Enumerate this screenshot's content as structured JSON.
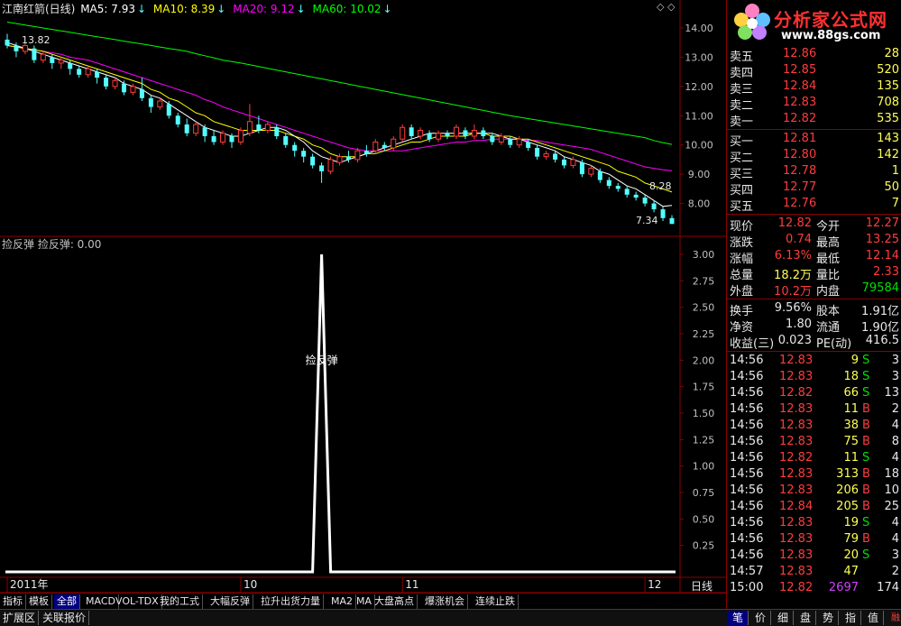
{
  "chart_header": {
    "stock": "江南红箭(日线)",
    "ma5_label": "MA5: 7.93",
    "ma10_label": "MA10: 8.39",
    "ma20_label": "MA20: 9.12",
    "ma60_label": "MA60: 10.02",
    "arrow": "↓",
    "corner_icons": "◇ ◇"
  },
  "indicator_title": "捡反弹  捡反弹: 0.00",
  "indicator_label": "捡反弹",
  "price_annotations": {
    "high": "13.82",
    "mid": "8.28",
    "low": "7.34"
  },
  "timeframe_label": "日线",
  "zoom_buttons": [
    "+",
    "-",
    "◇"
  ],
  "colors": {
    "ma5": "#ffffff",
    "ma10": "#ffff00",
    "ma20": "#ff00ff",
    "ma60": "#00ff00",
    "up": "#ff3c3c",
    "down": "#54ffff",
    "grid": "#8b0000",
    "axis_text": "#c0c0c0"
  },
  "chart_data": [
    {
      "type": "candlestick",
      "title": "江南红箭(日线)",
      "ylim": [
        7.0,
        14.4
      ],
      "yticks": [
        "14.00",
        "13.00",
        "12.00",
        "11.00",
        "10.00",
        "9.00",
        "8.00"
      ],
      "x_labels": [
        {
          "label": "2011年",
          "index": 0
        },
        {
          "label": "10",
          "index": 26
        },
        {
          "label": "11",
          "index": 44
        },
        {
          "label": "12",
          "index": 71
        }
      ],
      "candles": [
        [
          13.6,
          13.4,
          13.8,
          13.3
        ],
        [
          13.4,
          13.2,
          13.5,
          13.0
        ],
        [
          13.2,
          13.4,
          13.5,
          13.1
        ],
        [
          13.3,
          12.9,
          13.4,
          12.8
        ],
        [
          12.9,
          13.1,
          13.2,
          12.8
        ],
        [
          13.0,
          12.8,
          13.1,
          12.6
        ],
        [
          12.8,
          12.9,
          13.0,
          12.6
        ],
        [
          12.8,
          12.6,
          12.9,
          12.4
        ],
        [
          12.6,
          12.4,
          12.7,
          12.3
        ],
        [
          12.4,
          12.6,
          12.7,
          12.3
        ],
        [
          12.5,
          12.3,
          12.6,
          12.1
        ],
        [
          12.3,
          12.0,
          12.4,
          11.9
        ],
        [
          12.0,
          12.2,
          12.3,
          11.9
        ],
        [
          12.1,
          11.8,
          12.2,
          11.7
        ],
        [
          11.8,
          12.0,
          12.1,
          11.7
        ],
        [
          11.9,
          11.6,
          12.3,
          11.5
        ],
        [
          11.6,
          11.3,
          11.7,
          11.1
        ],
        [
          11.3,
          11.5,
          11.6,
          11.2
        ],
        [
          11.4,
          11.0,
          11.5,
          10.9
        ],
        [
          11.0,
          10.7,
          11.1,
          10.6
        ],
        [
          10.7,
          10.4,
          10.9,
          10.3
        ],
        [
          10.4,
          10.7,
          10.8,
          10.3
        ],
        [
          10.6,
          10.3,
          10.7,
          10.1
        ],
        [
          10.3,
          10.1,
          10.5,
          10.0
        ],
        [
          10.1,
          10.4,
          10.5,
          10.0
        ],
        [
          10.3,
          10.1,
          10.4,
          9.9
        ],
        [
          10.1,
          10.5,
          10.6,
          10.0
        ],
        [
          10.4,
          10.8,
          11.4,
          10.3
        ],
        [
          10.7,
          10.5,
          11.0,
          10.4
        ],
        [
          10.5,
          10.7,
          10.8,
          10.4
        ],
        [
          10.6,
          10.3,
          10.7,
          10.2
        ],
        [
          10.3,
          10.0,
          10.4,
          9.9
        ],
        [
          10.0,
          9.8,
          10.1,
          9.6
        ],
        [
          9.8,
          9.6,
          9.9,
          9.4
        ],
        [
          9.6,
          9.3,
          9.7,
          9.2
        ],
        [
          9.3,
          9.1,
          9.4,
          8.7
        ],
        [
          9.1,
          9.5,
          9.6,
          9.0
        ],
        [
          9.4,
          9.6,
          9.7,
          9.3
        ],
        [
          9.6,
          9.5,
          9.8,
          9.4
        ],
        [
          9.5,
          9.8,
          9.9,
          9.4
        ],
        [
          9.8,
          9.7,
          10.0,
          9.6
        ],
        [
          9.8,
          10.1,
          10.2,
          9.7
        ],
        [
          10.0,
          9.9,
          10.1,
          9.8
        ],
        [
          9.9,
          10.2,
          10.3,
          9.8
        ],
        [
          10.2,
          10.6,
          10.7,
          10.1
        ],
        [
          10.6,
          10.3,
          10.7,
          10.2
        ],
        [
          10.3,
          10.5,
          10.6,
          10.2
        ],
        [
          10.4,
          10.2,
          10.5,
          10.1
        ],
        [
          10.2,
          10.4,
          10.5,
          10.1
        ],
        [
          10.4,
          10.3,
          10.5,
          10.2
        ],
        [
          10.3,
          10.6,
          10.7,
          10.2
        ],
        [
          10.5,
          10.3,
          10.6,
          10.2
        ],
        [
          10.3,
          10.5,
          10.7,
          10.2
        ],
        [
          10.5,
          10.3,
          10.6,
          10.2
        ],
        [
          10.3,
          10.1,
          10.4,
          10.0
        ],
        [
          10.1,
          10.3,
          10.4,
          10.0
        ],
        [
          10.2,
          10.0,
          10.3,
          9.9
        ],
        [
          10.0,
          10.2,
          10.3,
          9.9
        ],
        [
          10.1,
          9.9,
          10.2,
          9.8
        ],
        [
          9.9,
          9.6,
          10.0,
          9.5
        ],
        [
          9.6,
          9.7,
          9.8,
          9.5
        ],
        [
          9.7,
          9.5,
          9.8,
          9.4
        ],
        [
          9.5,
          9.3,
          9.6,
          9.2
        ],
        [
          9.3,
          9.5,
          9.6,
          9.2
        ],
        [
          9.4,
          9.0,
          9.5,
          8.9
        ],
        [
          9.0,
          9.2,
          9.3,
          8.9
        ],
        [
          9.1,
          8.8,
          9.2,
          8.7
        ],
        [
          8.8,
          8.6,
          8.9,
          8.5
        ],
        [
          8.6,
          8.5,
          8.7,
          8.4
        ],
        [
          8.5,
          8.3,
          8.6,
          8.2
        ],
        [
          8.3,
          8.2,
          8.4,
          8.1
        ],
        [
          8.2,
          8.0,
          8.3,
          7.9
        ],
        [
          8.0,
          7.8,
          8.1,
          7.7
        ],
        [
          7.8,
          7.5,
          7.9,
          7.4
        ],
        [
          7.5,
          7.3,
          7.6,
          7.3
        ]
      ],
      "ma5": [
        13.5,
        13.4,
        13.3,
        13.2,
        13.1,
        13.0,
        12.9,
        12.8,
        12.7,
        12.6,
        12.5,
        12.4,
        12.3,
        12.1,
        12.0,
        11.9,
        11.7,
        11.6,
        11.4,
        11.2,
        11.0,
        10.8,
        10.6,
        10.5,
        10.4,
        10.3,
        10.3,
        10.4,
        10.5,
        10.6,
        10.6,
        10.5,
        10.3,
        10.1,
        9.8,
        9.6,
        9.5,
        9.4,
        9.5,
        9.6,
        9.7,
        9.8,
        9.9,
        10.0,
        10.1,
        10.2,
        10.3,
        10.4,
        10.4,
        10.4,
        10.4,
        10.4,
        10.4,
        10.4,
        10.4,
        10.3,
        10.2,
        10.2,
        10.1,
        10.0,
        9.9,
        9.8,
        9.6,
        9.5,
        9.4,
        9.3,
        9.1,
        9.0,
        8.8,
        8.6,
        8.5,
        8.3,
        8.1,
        7.9,
        7.93
      ],
      "ma10": [
        13.4,
        13.35,
        13.3,
        13.25,
        13.2,
        13.1,
        13.0,
        12.9,
        12.8,
        12.7,
        12.6,
        12.5,
        12.4,
        12.3,
        12.2,
        12.1,
        11.9,
        11.8,
        11.6,
        11.5,
        11.3,
        11.1,
        11.0,
        10.8,
        10.7,
        10.6,
        10.5,
        10.5,
        10.5,
        10.5,
        10.5,
        10.4,
        10.3,
        10.2,
        10.0,
        9.9,
        9.7,
        9.6,
        9.6,
        9.6,
        9.7,
        9.7,
        9.8,
        9.9,
        10.0,
        10.1,
        10.1,
        10.2,
        10.3,
        10.3,
        10.3,
        10.3,
        10.4,
        10.4,
        10.3,
        10.3,
        10.3,
        10.2,
        10.2,
        10.1,
        10.0,
        9.9,
        9.8,
        9.7,
        9.6,
        9.5,
        9.4,
        9.3,
        9.1,
        9.0,
        8.9,
        8.7,
        8.6,
        8.5,
        8.39
      ],
      "ma20": [
        13.4,
        13.35,
        13.3,
        13.25,
        13.2,
        13.15,
        13.1,
        13.0,
        12.95,
        12.9,
        12.8,
        12.7,
        12.6,
        12.5,
        12.4,
        12.3,
        12.2,
        12.1,
        12.0,
        11.9,
        11.8,
        11.7,
        11.55,
        11.45,
        11.3,
        11.2,
        11.1,
        11.0,
        10.9,
        10.8,
        10.7,
        10.6,
        10.5,
        10.4,
        10.3,
        10.2,
        10.1,
        10.0,
        9.9,
        9.85,
        9.8,
        9.8,
        9.8,
        9.8,
        9.8,
        9.85,
        9.9,
        9.95,
        10.0,
        10.05,
        10.1,
        10.1,
        10.15,
        10.15,
        10.2,
        10.2,
        10.2,
        10.2,
        10.15,
        10.15,
        10.1,
        10.05,
        10.0,
        9.95,
        9.9,
        9.85,
        9.75,
        9.65,
        9.55,
        9.45,
        9.35,
        9.25,
        9.2,
        9.15,
        9.12
      ],
      "ma60": [
        14.2,
        14.15,
        14.1,
        14.05,
        14.0,
        13.95,
        13.9,
        13.85,
        13.8,
        13.75,
        13.7,
        13.65,
        13.6,
        13.55,
        13.5,
        13.45,
        13.4,
        13.35,
        13.3,
        13.25,
        13.2,
        13.12,
        13.05,
        12.98,
        12.9,
        12.85,
        12.8,
        12.74,
        12.68,
        12.62,
        12.56,
        12.5,
        12.44,
        12.38,
        12.32,
        12.26,
        12.2,
        12.14,
        12.08,
        12.02,
        11.96,
        11.9,
        11.84,
        11.78,
        11.72,
        11.66,
        11.6,
        11.54,
        11.48,
        11.42,
        11.36,
        11.3,
        11.24,
        11.18,
        11.12,
        11.06,
        11.0,
        10.95,
        10.9,
        10.85,
        10.8,
        10.75,
        10.7,
        10.65,
        10.6,
        10.55,
        10.5,
        10.45,
        10.4,
        10.35,
        10.3,
        10.25,
        10.15,
        10.08,
        10.02
      ]
    },
    {
      "type": "line",
      "title": "捡反弹",
      "ylim": [
        0,
        3.0
      ],
      "yticks": [
        "3.00",
        "2.75",
        "2.50",
        "2.25",
        "2.00",
        "1.75",
        "1.50",
        "1.25",
        "1.00",
        "0.75",
        "0.50",
        "0.25"
      ],
      "spike_index": 35,
      "spike_value": 3.0
    }
  ],
  "logo": {
    "text": "分析家公式网",
    "url_text": "www.88gs.com"
  },
  "order_book": {
    "sell": [
      {
        "label": "卖五",
        "price": "12.86",
        "vol": "28"
      },
      {
        "label": "卖四",
        "price": "12.85",
        "vol": "520"
      },
      {
        "label": "卖三",
        "price": "12.84",
        "vol": "135"
      },
      {
        "label": "卖二",
        "price": "12.83",
        "vol": "708"
      },
      {
        "label": "卖一",
        "price": "12.82",
        "vol": "535"
      }
    ],
    "buy": [
      {
        "label": "买一",
        "price": "12.81",
        "vol": "143"
      },
      {
        "label": "买二",
        "price": "12.80",
        "vol": "142"
      },
      {
        "label": "买三",
        "price": "12.78",
        "vol": "1"
      },
      {
        "label": "买四",
        "price": "12.77",
        "vol": "50"
      },
      {
        "label": "买五",
        "price": "12.76",
        "vol": "7"
      }
    ]
  },
  "quote": [
    {
      "l1": "现价",
      "v1": "12.82",
      "c1": "red",
      "l2": "今开",
      "v2": "12.27",
      "c2": "red"
    },
    {
      "l1": "涨跌",
      "v1": "0.74",
      "c1": "red",
      "l2": "最高",
      "v2": "13.25",
      "c2": "red"
    },
    {
      "l1": "涨幅",
      "v1": "6.13%",
      "c1": "red",
      "l2": "最低",
      "v2": "12.14",
      "c2": "red"
    },
    {
      "l1": "总量",
      "v1": "18.2万",
      "c1": "yellow",
      "l2": "量比",
      "v2": "2.33",
      "c2": "red"
    },
    {
      "l1": "外盘",
      "v1": "10.2万",
      "c1": "red",
      "l2": "内盘",
      "v2": "79584",
      "c2": "green"
    }
  ],
  "finance": [
    {
      "l1": "换手",
      "v1": "9.56%",
      "l2": "股本",
      "v2": "1.91亿"
    },
    {
      "l1": "净资",
      "v1": "1.80",
      "l2": "流通",
      "v2": "1.90亿"
    },
    {
      "l1": "收益(三)",
      "v1": "0.023",
      "l2": "PE(动)",
      "v2": "416.5"
    }
  ],
  "ticks": [
    {
      "time": "14:56",
      "price": "12.83",
      "vol": "9",
      "bs": "S",
      "n": "3"
    },
    {
      "time": "14:56",
      "price": "12.83",
      "vol": "18",
      "bs": "S",
      "n": "3"
    },
    {
      "time": "14:56",
      "price": "12.82",
      "vol": "66",
      "bs": "S",
      "n": "13"
    },
    {
      "time": "14:56",
      "price": "12.83",
      "vol": "11",
      "bs": "B",
      "n": "2"
    },
    {
      "time": "14:56",
      "price": "12.83",
      "vol": "38",
      "bs": "B",
      "n": "4"
    },
    {
      "time": "14:56",
      "price": "12.83",
      "vol": "75",
      "bs": "B",
      "n": "8"
    },
    {
      "time": "14:56",
      "price": "12.82",
      "vol": "11",
      "bs": "S",
      "n": "4"
    },
    {
      "time": "14:56",
      "price": "12.83",
      "vol": "313",
      "bs": "B",
      "n": "18"
    },
    {
      "time": "14:56",
      "price": "12.83",
      "vol": "206",
      "bs": "B",
      "n": "10"
    },
    {
      "time": "14:56",
      "price": "12.84",
      "vol": "205",
      "bs": "B",
      "n": "25"
    },
    {
      "time": "14:56",
      "price": "12.83",
      "vol": "19",
      "bs": "S",
      "n": "4"
    },
    {
      "time": "14:56",
      "price": "12.83",
      "vol": "79",
      "bs": "B",
      "n": "4"
    },
    {
      "time": "14:56",
      "price": "12.83",
      "vol": "20",
      "bs": "S",
      "n": "3"
    },
    {
      "time": "14:57",
      "price": "12.83",
      "vol": "47",
      "bs": "",
      "n": "2"
    },
    {
      "time": "15:00",
      "price": "12.82",
      "vol": "2697",
      "bs": "",
      "n": "174"
    }
  ],
  "indicator_tabs": [
    "指标",
    "模板",
    "全部",
    "MACD",
    "VOL-TDX",
    "我的工式",
    "大幅反弹",
    "拉升出货力量",
    "MA2",
    "MA",
    "大盘高点",
    "爆涨机会",
    "连续止跌"
  ],
  "active_indicator_tab": "全部",
  "bottom_tabs": [
    "扩展区",
    "关联报价"
  ],
  "right_tabs": [
    "笔",
    "价",
    "细",
    "盘",
    "势",
    "指",
    "值"
  ],
  "right_corner_text": "融"
}
